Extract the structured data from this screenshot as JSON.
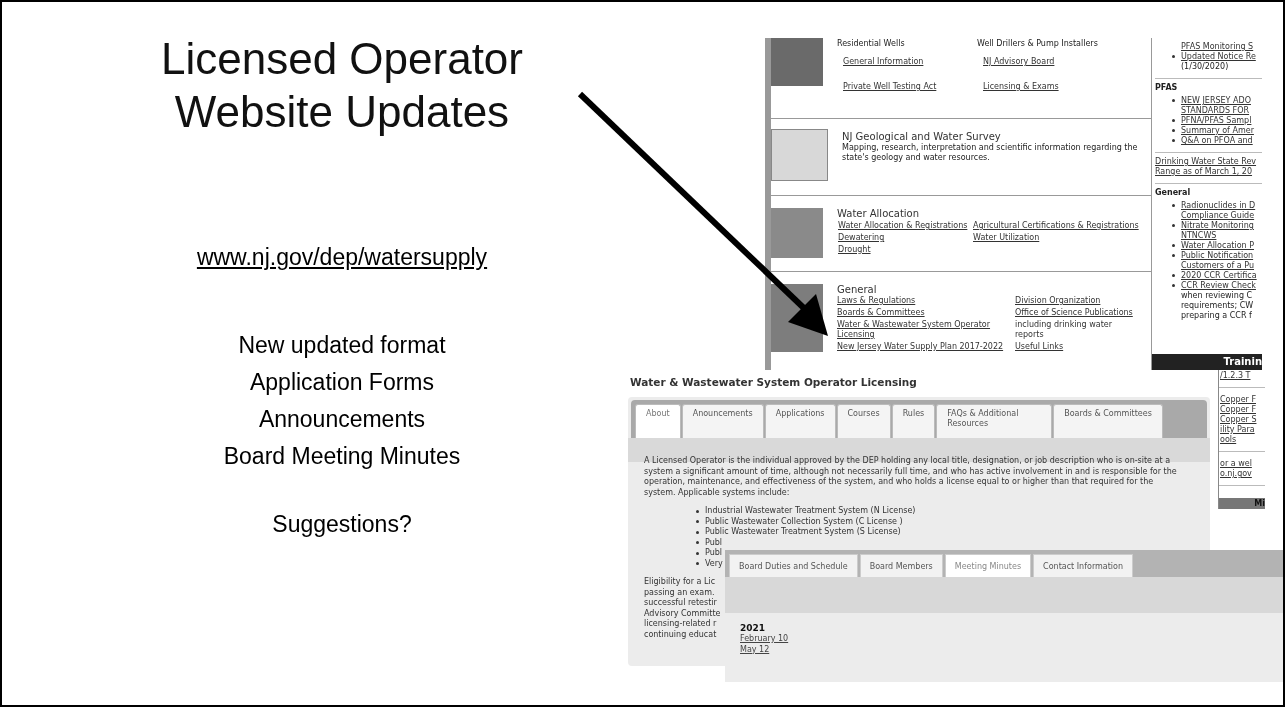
{
  "slide": {
    "title_lines": [
      "Licensed Operator",
      "Website Updates"
    ],
    "url": "www.nj.gov/dep/watersupply",
    "points": [
      "New updated format",
      "Application Forms",
      "Announcements",
      "Board Meeting Minutes"
    ],
    "question": "Suggestions?"
  },
  "division_page": {
    "sections": [
      {
        "kind": "photo",
        "columns": [
          {
            "heading": "Residential Wells",
            "items": [
              {
                "kind": "link",
                "text": "General Information"
              },
              {
                "kind": "link",
                "text": "Private Well Testing Act"
              }
            ]
          },
          {
            "heading": "Well Drillers & Pump Installers",
            "items": [
              {
                "kind": "link",
                "text": "NJ Advisory Board"
              },
              {
                "kind": "link",
                "text": "Licensing & Exams"
              }
            ]
          }
        ]
      },
      {
        "kind": "map",
        "title": "NJ Geological and Water Survey",
        "description": "Mapping, research, interpretation and scientific information regarding the state's geology and water resources."
      },
      {
        "kind": "photo",
        "title": "Water Allocation",
        "columns": [
          {
            "items": [
              {
                "kind": "link",
                "text": "Water Allocation & Registrations"
              },
              {
                "kind": "link",
                "text": "Dewatering"
              },
              {
                "kind": "link",
                "text": "Drought"
              }
            ]
          },
          {
            "items": [
              {
                "kind": "link",
                "text": "Agricultural Certifications & Registrations"
              },
              {
                "kind": "link",
                "text": "Water Utilization"
              }
            ]
          }
        ]
      },
      {
        "kind": "photo",
        "title": "General",
        "columns": [
          {
            "items": [
              {
                "kind": "link",
                "text": "Laws & Regulations"
              },
              {
                "kind": "link",
                "text": "Boards & Committees"
              },
              {
                "kind": "link",
                "text": "Water & Wastewater System Operator Licensing"
              },
              {
                "kind": "link",
                "text": "New Jersey Water Supply Plan 2017-2022"
              }
            ]
          },
          {
            "items": [
              {
                "kind": "link",
                "text": "Division Organization"
              },
              {
                "kind": "link",
                "text": "Office of Science Publications"
              },
              {
                "kind": "text",
                "text": "including drinking water reports"
              },
              {
                "kind": "link",
                "text": "Useful Links"
              }
            ]
          }
        ]
      }
    ],
    "sidebar": [
      {
        "items": [
          {
            "bullet": false,
            "links": [
              "PFAS Monitoring S"
            ]
          },
          {
            "bullet": true,
            "links": [
              "Updated Notice Re"
            ],
            "notes": [
              "(1/30/2020)"
            ]
          }
        ]
      },
      {
        "heading": "PFAS",
        "items": [
          {
            "bullet": true,
            "links": [
              "NEW JERSEY ADO",
              "STANDARDS FOR"
            ]
          },
          {
            "bullet": true,
            "links": [
              "PFNA/PFAS Sampl"
            ]
          },
          {
            "bullet": true,
            "links": [
              "Summary of Amer"
            ]
          },
          {
            "bullet": true,
            "links": [
              "Q&A on PFOA and"
            ]
          }
        ]
      },
      {
        "flat": true,
        "items": [
          {
            "bullet": false,
            "links": [
              "Drinking Water State Rev",
              "Range as of March 1, 20"
            ]
          }
        ]
      },
      {
        "heading": "General",
        "items": [
          {
            "bullet": true,
            "links": [
              "Radionuclides in D",
              "Compliance Guide"
            ]
          },
          {
            "bullet": true,
            "links": [
              "Nitrate Monitoring",
              "NTNCWS"
            ]
          },
          {
            "bullet": true,
            "links": [
              "Water Allocation P"
            ]
          },
          {
            "bullet": true,
            "links": [
              "Public Notification",
              "Customers of a Pu"
            ]
          },
          {
            "bullet": true,
            "links": [
              "2020 CCR Certifica"
            ]
          },
          {
            "bullet": true,
            "links": [
              "CCR Review Check"
            ],
            "notes": [
              "when reviewing C",
              "requirements; CW",
              "preparing a CCR f"
            ]
          }
        ]
      }
    ],
    "bar": "Trainin",
    "strip": {
      "groups": [
        [
          "/1.2.3 T"
        ],
        [
          "Copper F",
          "Copper F",
          "Copper S",
          "ility Para",
          "ools"
        ],
        [
          "or a wel",
          "o.nj.gov"
        ]
      ],
      "bar": "Mi"
    }
  },
  "licensing_page": {
    "heading": "Water & Wastewater System Operator Licensing",
    "tabs": [
      {
        "label": "About",
        "selected": true
      },
      {
        "label": "Anouncements",
        "selected": false
      },
      {
        "label": "Applications",
        "selected": false
      },
      {
        "label": "Courses",
        "selected": false
      },
      {
        "label": "Rules",
        "selected": false
      },
      {
        "label": "FAQs & Additional Resources",
        "selected": false
      },
      {
        "label": "Boards & Committees",
        "selected": false
      }
    ],
    "intro": "A Licensed Operator is the individual approved by the DEP holding any local title, designation, or job description who is on-site at a system a significant amount of time, although not necessarily full time, and who has active involvement in and is responsible for the operation, maintenance, and effectiveness of the system, and who holds a license equal to or higher than that required for the system.  Applicable systems include:",
    "systems": [
      "Industrial Wastewater Treatment System (N License)",
      "Public Wastewater Collection System (C License )",
      "Public Wastewater Treatment System (S License)",
      "Publ",
      "Publ",
      "Very"
    ],
    "eligibility_lines": [
      "Eligibility for a Lic",
      "passing an exam.",
      "successful retestir",
      "Advisory Committe",
      "licensing-related r",
      "continuing educat"
    ]
  },
  "board_page": {
    "tabs": [
      {
        "label": "Board Duties and Schedule",
        "selected": false
      },
      {
        "label": "Board Members",
        "selected": false
      },
      {
        "label": "Meeting Minutes",
        "selected": true
      },
      {
        "label": "Contact Information",
        "selected": false
      }
    ],
    "year": "2021",
    "minutes": [
      "February 10",
      "May 12"
    ]
  }
}
